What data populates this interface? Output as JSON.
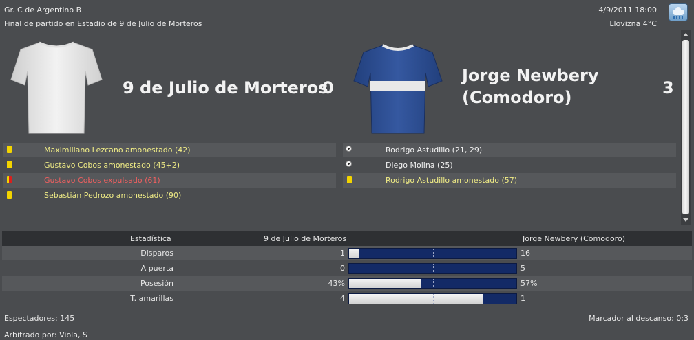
{
  "header": {
    "competition": "Gr. C de Argentino B",
    "match_status": "Final de partido en Estadio de 9 de Julio de Morteros",
    "datetime": "4/9/2011 18:00",
    "weather": "Llovizna 4°C"
  },
  "home": {
    "name": "9 de Julio de Morteros",
    "score": "0",
    "shirt_colors": {
      "body": "#e9e9e9",
      "trim": "#ffffff"
    },
    "events": [
      {
        "icon": "yellow-card",
        "text": "Maximiliano Lezcano amonestado (42)",
        "color": "yellow"
      },
      {
        "icon": "yellow-card",
        "text": "Gustavo Cobos amonestado (45+2)",
        "color": "yellow"
      },
      {
        "icon": "red-card",
        "text": "Gustavo Cobos expulsado (61)",
        "color": "red"
      },
      {
        "icon": "yellow-card",
        "text": "Sebastián Pedrozo amonestado (90)",
        "color": "yellow"
      }
    ]
  },
  "away": {
    "name_line1": "Jorge Newbery",
    "name_line2": "(Comodoro)",
    "score": "3",
    "shirt_colors": {
      "body": "#2c4a8c",
      "band": "#e8e8e8"
    },
    "events": [
      {
        "icon": "ball-icon",
        "text": "Rodrigo Astudillo (21, 29)",
        "color": "white"
      },
      {
        "icon": "ball-icon",
        "text": "Diego Molina (25)",
        "color": "white"
      },
      {
        "icon": "yellow-card",
        "text": "Rodrigo Astudillo amonestado (57)",
        "color": "yellow"
      }
    ]
  },
  "stats": {
    "header_label": "Estadística",
    "home_team": "9 de Julio de Morteros",
    "away_team": "Jorge Newbery (Comodoro)",
    "rows": [
      {
        "label": "Disparos",
        "home": "1",
        "away": "16",
        "home_share": 0.06
      },
      {
        "label": "A puerta",
        "home": "0",
        "away": "5",
        "home_share": 0.0
      },
      {
        "label": "Posesión",
        "home": "43%",
        "away": "57%",
        "home_share": 0.43
      },
      {
        "label": "T. amarillas",
        "home": "4",
        "away": "1",
        "home_share": 0.8
      }
    ]
  },
  "footer": {
    "attendance": "Espectadores: 145",
    "halftime": "Marcador al descanso: 0:3",
    "referee": "Arbitrado por: Viola, S"
  },
  "colors": {
    "background": "#4a4c4f",
    "away_bar": "#132a66",
    "yellow_text": "#f0ec86",
    "red_text": "#f06060"
  }
}
